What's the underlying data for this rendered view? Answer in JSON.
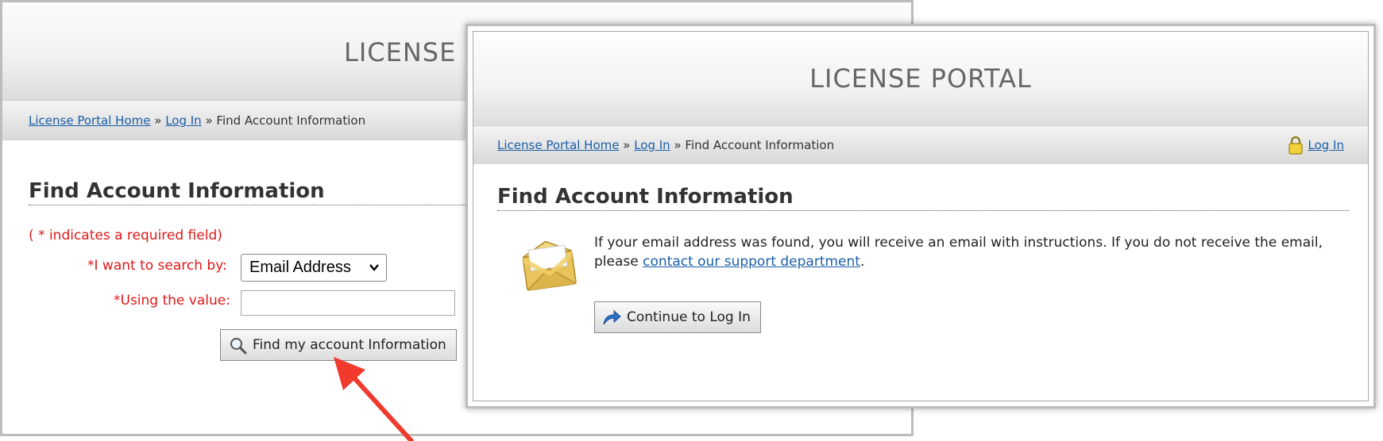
{
  "left_window": {
    "title": "LICENSE",
    "breadcrumb": {
      "home": "License Portal Home",
      "sep1": " » ",
      "login": "Log In",
      "sep2": " » ",
      "current": "Find Account Information"
    },
    "heading": "Find Account Information",
    "required_note": "( * indicates a required field)",
    "search_by_label": "*I want to search by:",
    "search_by_value": "Email Address",
    "using_value_label": "*Using the value:",
    "using_value_input": "",
    "find_button_label": "Find my account Information"
  },
  "right_window": {
    "title": "LICENSE PORTAL",
    "breadcrumb": {
      "home": "License Portal Home",
      "sep1": " » ",
      "login": "Log In",
      "sep2": " » ",
      "current": "Find Account Information"
    },
    "login_link": "Log In",
    "heading": "Find Account Information",
    "message_part1": "If your email address was found, you will receive an email with instructions. If you do not receive the email, please ",
    "message_link": "contact our support department",
    "message_end": ".",
    "continue_button_label": "Continue to Log In"
  },
  "annotation": {
    "arrow_color": "#f03a2e"
  },
  "colors": {
    "link": "#1a5ea8",
    "required": "#e01818",
    "title_gray": "#666666"
  },
  "icons": {
    "search": "magnifier-icon",
    "lock": "padlock-icon",
    "mail": "envelope-icon",
    "continue": "forward-arrow-icon"
  }
}
